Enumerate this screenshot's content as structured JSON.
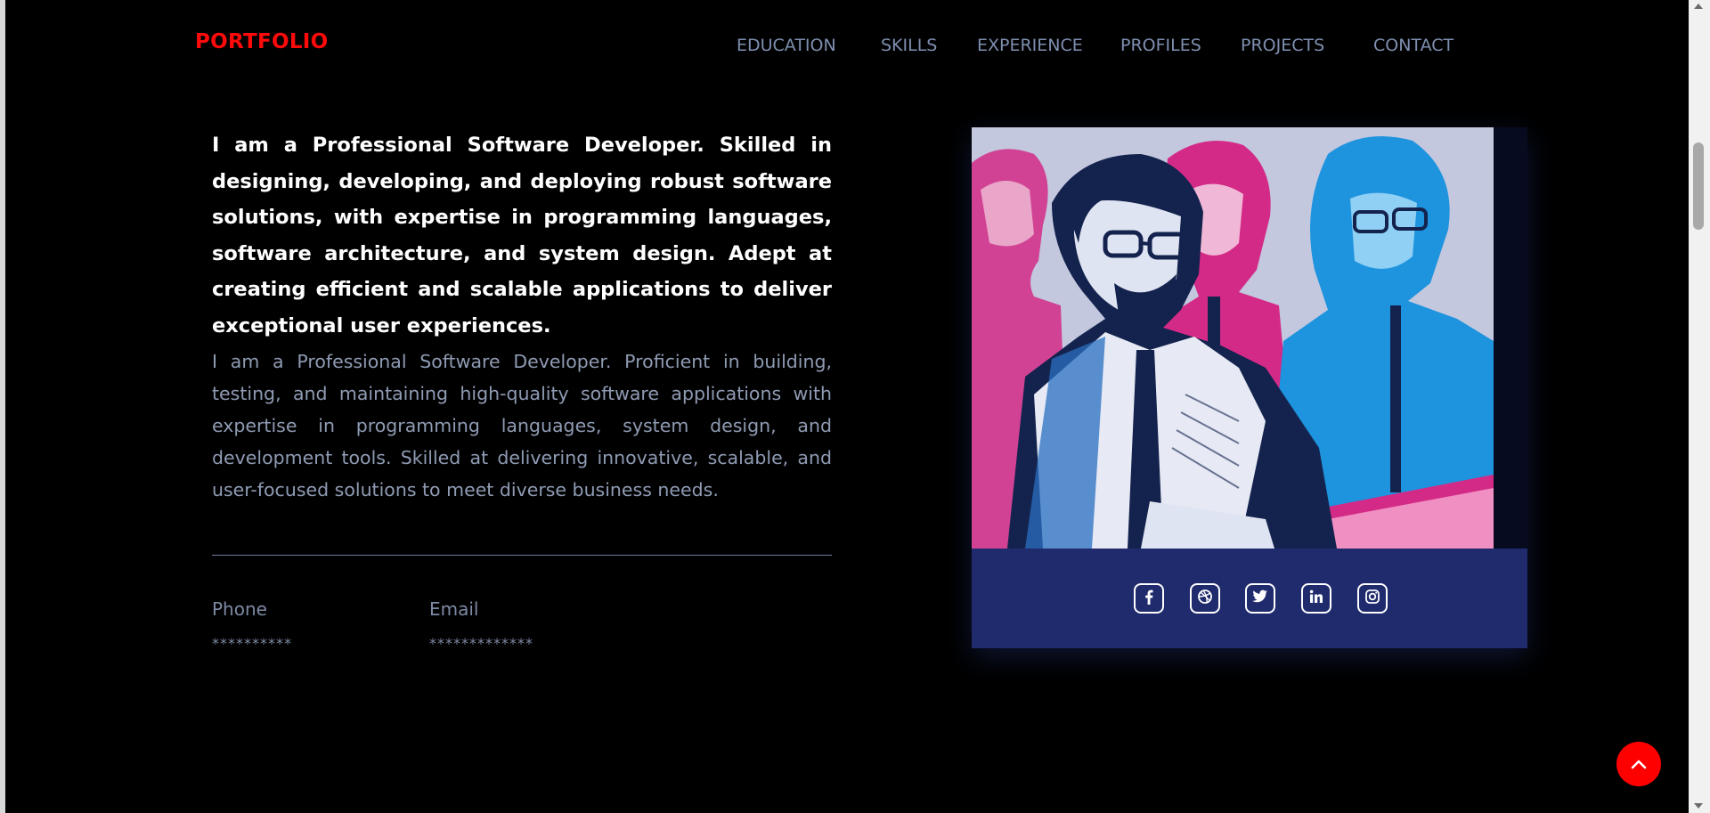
{
  "header": {
    "logo": "PORTFOLIO",
    "nav": [
      "EDUCATION",
      "SKILLS",
      "EXPERIENCE",
      "PROFILES",
      "PROJECTS",
      "CONTACT"
    ]
  },
  "about": {
    "lead": "I am a Professional Software Developer. Skilled in designing, developing, and deploying robust software solutions, with expertise in programming languages, software architecture, and system design. Adept at creating efficient and scalable applications to deliver exceptional user experiences.",
    "description": "I am a Professional Software Developer. Proficient in building, testing, and maintaining high-quality software applications with expertise in programming languages, system design, and development tools. Skilled at delivering innovative, scalable, and user-focused solutions to meet diverse business needs."
  },
  "contact": {
    "phone_label": "Phone",
    "phone_value": "**********",
    "email_label": "Email",
    "email_value": "*************"
  },
  "social": {
    "icons": [
      "facebook-icon",
      "dribbble-icon",
      "twitter-icon",
      "linkedin-icon",
      "instagram-icon"
    ]
  },
  "colors": {
    "background": "#000000",
    "logo": "#ff0a0a",
    "nav_text": "#7e8fb0",
    "muted_text": "#8f9bb3",
    "social_bar": "#1f2b6c",
    "to_top": "#ff0000",
    "illustration_bg": "#c3c8de",
    "magenta": "#d42a87",
    "blue": "#1e93de",
    "navy": "#14234e"
  }
}
